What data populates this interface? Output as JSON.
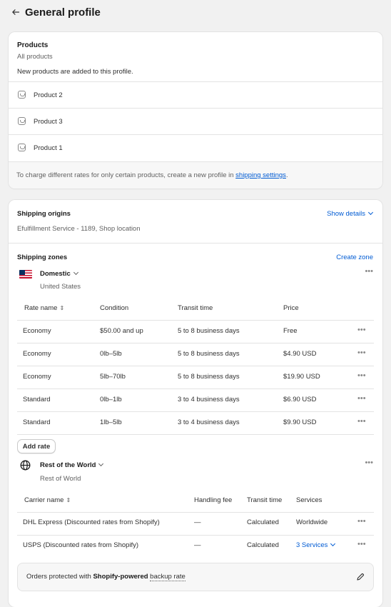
{
  "header": {
    "title": "General profile"
  },
  "products": {
    "heading": "Products",
    "subheading": "All products",
    "note": "New products are added to this profile.",
    "items": [
      "Product 2",
      "Product 3",
      "Product 1"
    ],
    "footer_text": "To charge different rates for only certain products, create a new profile in ",
    "footer_link": "shipping settings",
    "footer_end": "."
  },
  "origins": {
    "heading": "Shipping origins",
    "detail": "Efulfillment Service - 1189, Shop location",
    "show_details": "Show details"
  },
  "zones": {
    "heading": "Shipping zones",
    "create_zone": "Create zone",
    "domestic": {
      "name": "Domestic",
      "region": "United States",
      "headers": {
        "rate": "Rate name",
        "condition": "Condition",
        "transit": "Transit time",
        "price": "Price"
      },
      "rows": [
        {
          "rate": "Economy",
          "condition": "$50.00 and up",
          "transit": "5 to 8 business days",
          "price": "Free"
        },
        {
          "rate": "Economy",
          "condition": "0lb–5lb",
          "transit": "5 to 8 business days",
          "price": "$4.90 USD"
        },
        {
          "rate": "Economy",
          "condition": "5lb–70lb",
          "transit": "5 to 8 business days",
          "price": "$19.90 USD"
        },
        {
          "rate": "Standard",
          "condition": "0lb–1lb",
          "transit": "3 to 4 business days",
          "price": "$6.90 USD"
        },
        {
          "rate": "Standard",
          "condition": "1lb–5lb",
          "transit": "3 to 4 business days",
          "price": "$9.90 USD"
        }
      ],
      "add_rate": "Add rate"
    },
    "world": {
      "name": "Rest of the World",
      "region": "Rest of World",
      "headers": {
        "carrier": "Carrier name",
        "handling": "Handling fee",
        "transit": "Transit time",
        "services": "Services"
      },
      "rows": [
        {
          "carrier": "DHL Express (Discounted rates from Shopify)",
          "handling": "—",
          "transit": "Calculated",
          "services": "Worldwide"
        },
        {
          "carrier": "USPS (Discounted rates from Shopify)",
          "handling": "—",
          "transit": "Calculated",
          "services": "3 Services"
        }
      ]
    },
    "banner": {
      "prefix": "Orders protected with ",
      "bold": "Shopify-powered",
      "space": " ",
      "link": "backup rate"
    }
  },
  "colors": {
    "link": "#005bd3",
    "text": "#303030",
    "subdued": "#616161",
    "background": "#f1f1f1"
  }
}
